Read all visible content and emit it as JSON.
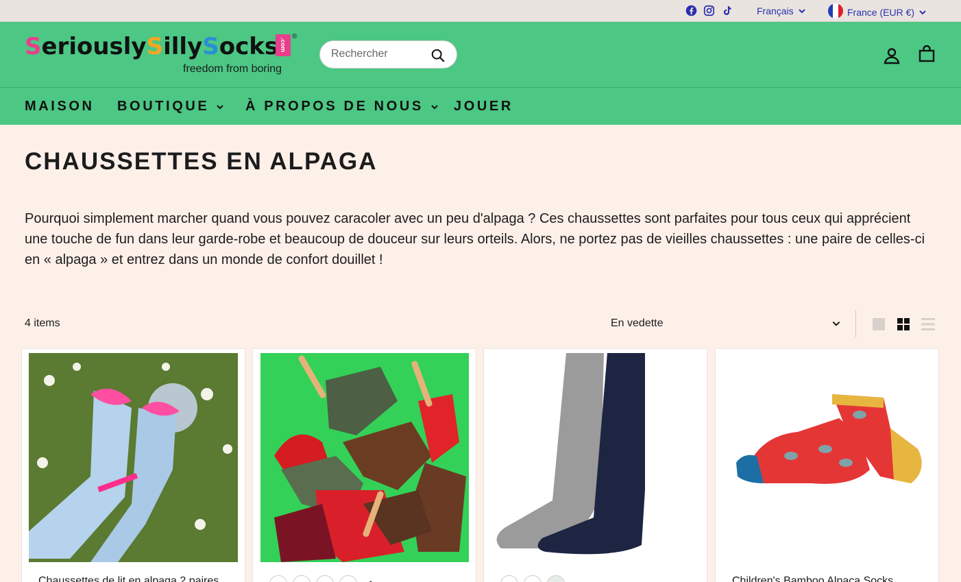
{
  "utility": {
    "social_icons": [
      "facebook-icon",
      "instagram-icon",
      "tiktok-icon"
    ],
    "language": "Français",
    "country": "France (EUR €)",
    "link_color": "#2a2fb0"
  },
  "header": {
    "logo_text": "SeriouslySillySocks",
    "logo_badge": ".com",
    "logo_reg": "®",
    "tagline": "freedom from boring",
    "search_placeholder": "Rechercher",
    "bg_color": "#4cc784"
  },
  "nav": {
    "items": [
      {
        "label": "MAISON"
      },
      {
        "label": "BOUTIQUE"
      },
      {
        "label": "À PROPOS DE NOUS"
      },
      {
        "label": "JOUER"
      }
    ]
  },
  "collection": {
    "title": "CHAUSSETTES EN ALPAGA",
    "description": "Pourquoi simplement marcher quand vous pouvez caracoler avec un peu d'alpaga ? Ces chaussettes sont parfaites pour tous ceux qui apprécient une touche de fun dans leur garde-robe et beaucoup de douceur sur leurs orteils. Alors, ne portez pas de vieilles chaussettes : une paire de celles-ci en « alpaga » et entrez dans un monde de confort douillet !",
    "count": "4 items",
    "sort_value": "En vedette"
  },
  "products": [
    {
      "title": "Chaussettes de lit en alpaga 2 paires",
      "image": "pink-bow-socks-in-grass"
    },
    {
      "title": "",
      "image": "colored-alpaca-socks-pile",
      "swatch_more": "+1"
    },
    {
      "title": "",
      "image": "grey-and-navy-ribbed-socks"
    },
    {
      "title": "Children's Bamboo Alpaca Socks",
      "image": "red-alpaca-print-sock"
    }
  ]
}
